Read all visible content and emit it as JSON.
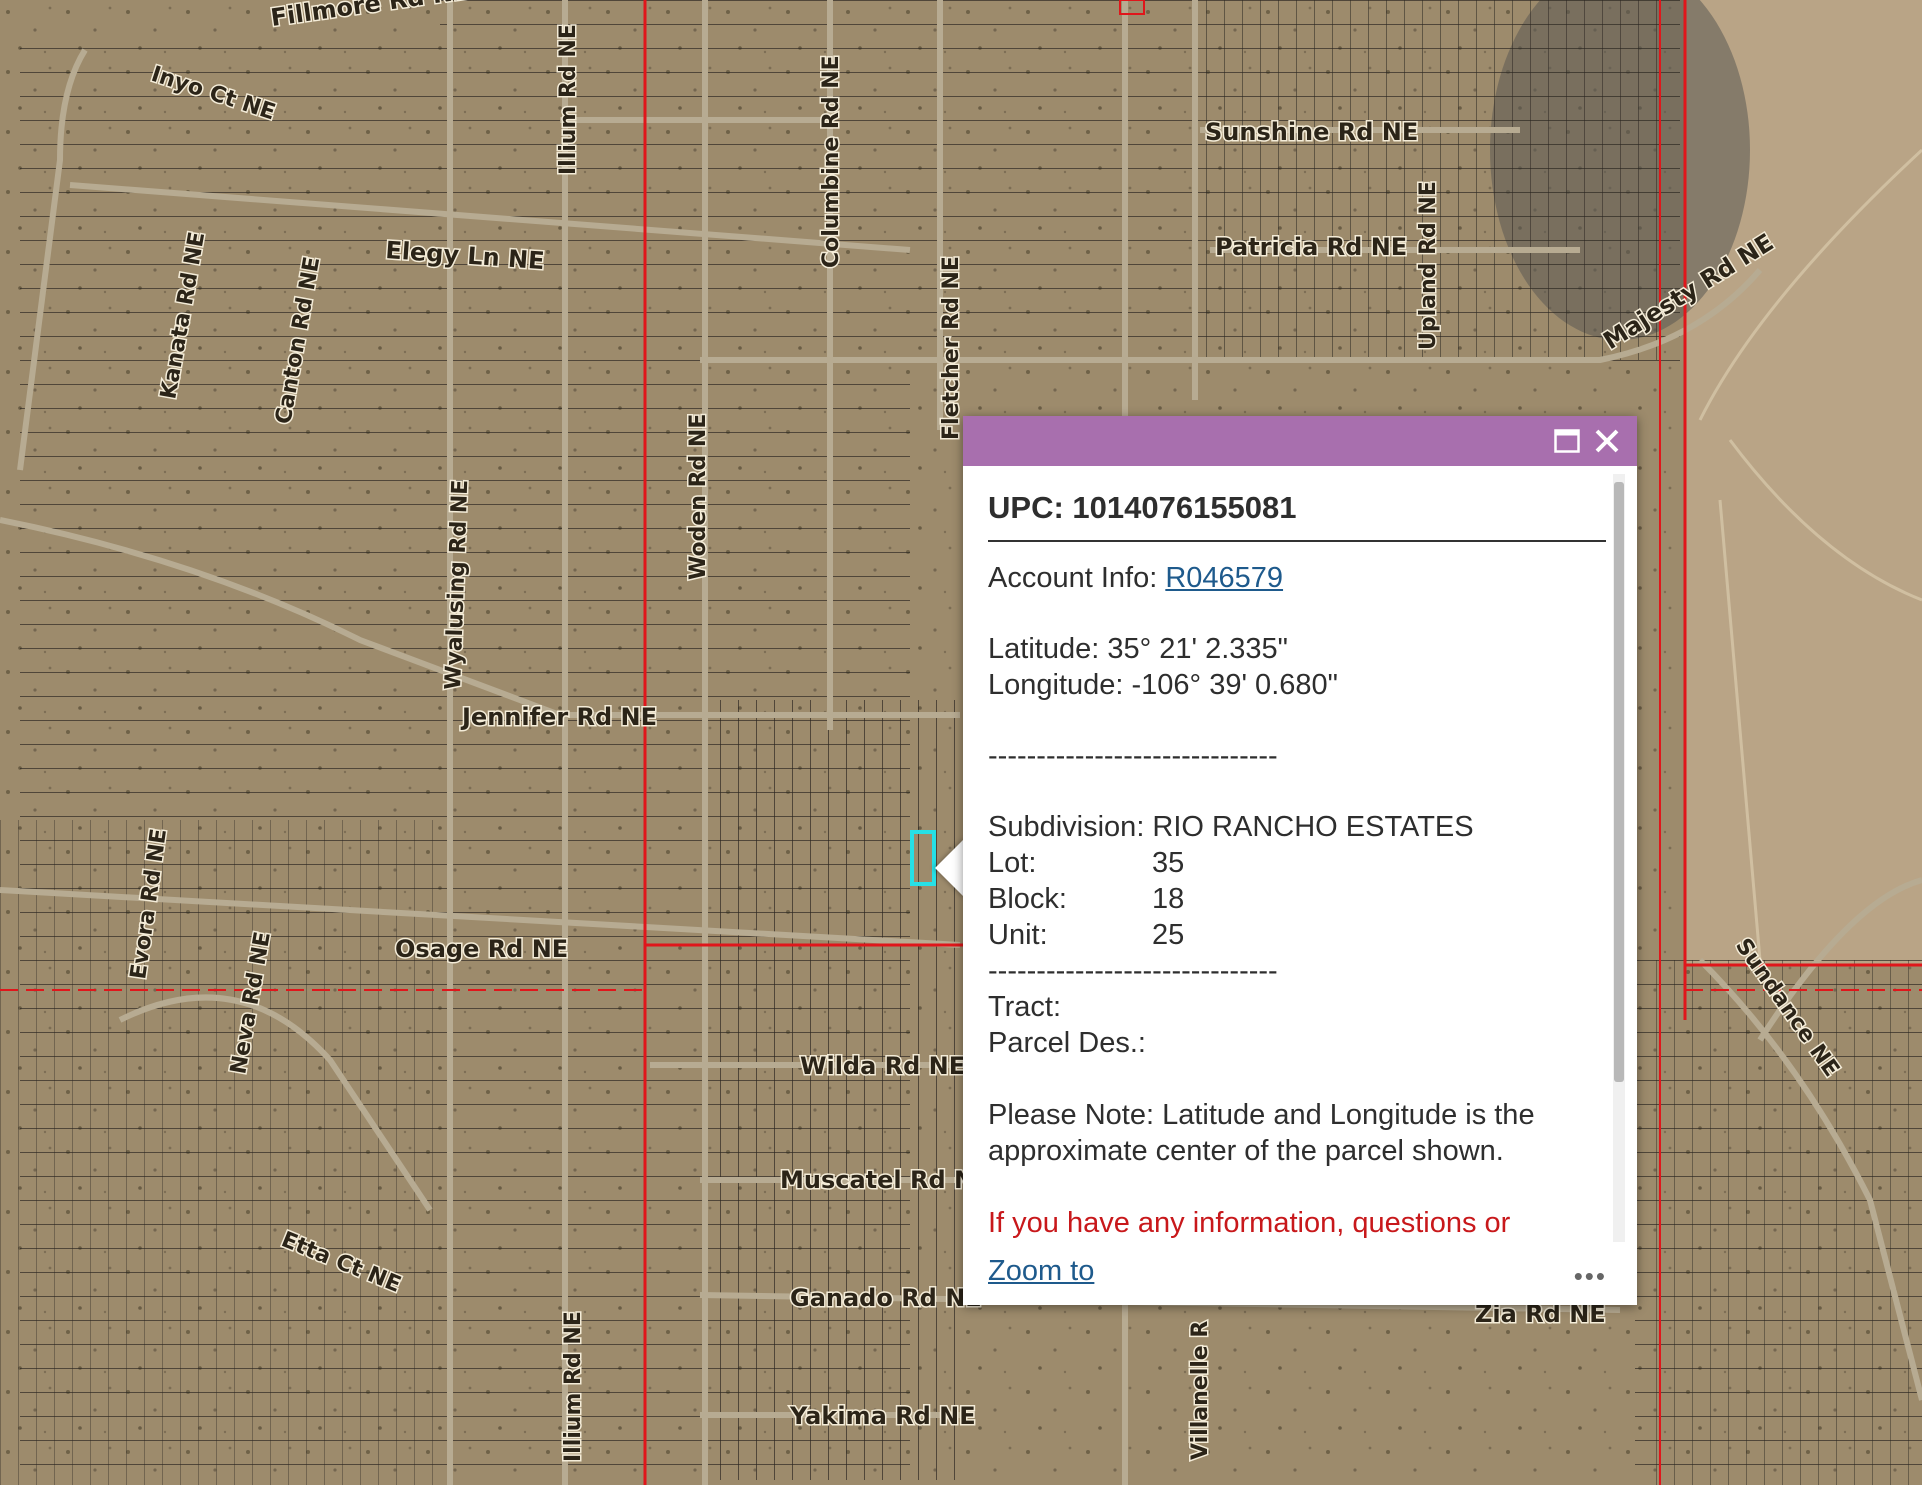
{
  "map": {
    "streets": [
      {
        "name": "Fillmore Rd NE"
      },
      {
        "name": "Inyo Ct NE"
      },
      {
        "name": "Elegy Ln NE"
      },
      {
        "name": "Kanata Rd NE"
      },
      {
        "name": "Canton Rd NE"
      },
      {
        "name": "Illium Rd NE"
      },
      {
        "name": "Columbine Rd NE"
      },
      {
        "name": "Fletcher Rd NE"
      },
      {
        "name": "Sunshine Rd NE"
      },
      {
        "name": "Patricia Rd NE"
      },
      {
        "name": "Upland Rd NE"
      },
      {
        "name": "Majesty Rd NE"
      },
      {
        "name": "Wyalusing Rd NE"
      },
      {
        "name": "Woden Rd NE"
      },
      {
        "name": "Jennifer Rd NE"
      },
      {
        "name": "Evora Rd NE"
      },
      {
        "name": "Neva Rd NE"
      },
      {
        "name": "Osage Rd NE"
      },
      {
        "name": "Wilda Rd NE"
      },
      {
        "name": "Muscatel Rd N"
      },
      {
        "name": "Ganado Rd NE"
      },
      {
        "name": "Etta Ct NE"
      },
      {
        "name": "Illium Rd NE"
      },
      {
        "name": "Yakima Rd NE"
      },
      {
        "name": "Villanelle R"
      },
      {
        "name": "Zia Rd NE"
      },
      {
        "name": "Sundance NE"
      }
    ],
    "colors": {
      "boundary": "#e0161b",
      "selection": "#26e0e6",
      "parcel_line": "#2a2620"
    }
  },
  "popup": {
    "header_color": "#a86fae",
    "maximize_icon": "maximize-icon",
    "close_icon": "close-icon",
    "upc_label": "UPC: 1014076155081",
    "account_label": "Account Info: ",
    "account_link": "R046579",
    "latitude": "Latitude: 35° 21' 2.335\"",
    "longitude": "Longitude: -106° 39' 0.680\"",
    "divider1": "------------------------------",
    "subdivision": "Subdivision: RIO RANCHO ESTATES",
    "lot_label": "Lot:",
    "lot_value": "35",
    "block_label": "Block:",
    "block_value": "18",
    "unit_label": "Unit:",
    "unit_value": "25",
    "divider2": "------------------------------",
    "tract": "Tract:",
    "parcel_des": "Parcel Des.:",
    "note": "Please Note: Latitude and Longitude is the approximate center of the parcel shown.",
    "info_note": "If you have any information, questions or",
    "zoom_link": "Zoom to",
    "more_icon": "more-options-icon",
    "more_glyph": "•••"
  }
}
